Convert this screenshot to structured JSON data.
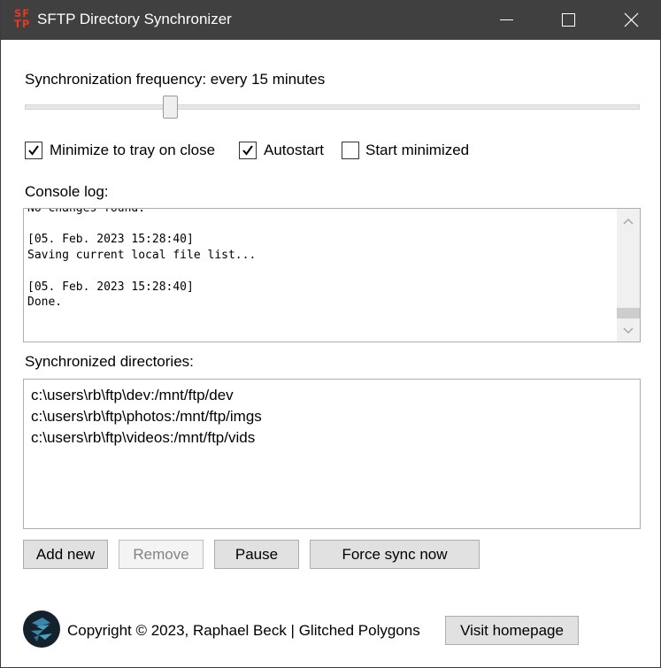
{
  "window": {
    "title": "SFTP Directory Synchronizer",
    "logo_text_top": "SF",
    "logo_text_bottom": "TP",
    "controls": [
      "minimize",
      "maximize",
      "close"
    ]
  },
  "sync": {
    "frequency_label": "Synchronization frequency: every 15 minutes",
    "slider_fraction": 0.23
  },
  "options": [
    {
      "label": "Minimize to tray on close",
      "checked": true
    },
    {
      "label": "Autostart",
      "checked": true
    },
    {
      "label": "Start minimized",
      "checked": false
    }
  ],
  "console": {
    "label": "Console log:",
    "lines": [
      "No changes found.",
      "",
      "[05. Feb. 2023 15:28:40]",
      "Saving current local file list...",
      "",
      "[05. Feb. 2023 15:28:40]",
      "Done."
    ]
  },
  "directories": {
    "label": "Synchronized directories:",
    "items": [
      "c:\\users\\rb\\ftp\\dev:/mnt/ftp/dev",
      "c:\\users\\rb\\ftp\\photos:/mnt/ftp/imgs",
      "c:\\users\\rb\\ftp\\videos:/mnt/ftp/vids"
    ]
  },
  "buttons": {
    "add_new": "Add new",
    "remove": "Remove",
    "pause": "Pause",
    "force_sync": "Force sync now",
    "visit_homepage": "Visit homepage"
  },
  "footer": {
    "copyright": "Copyright © 2023, Raphael Beck | Glitched Polygons"
  },
  "colors": {
    "titlebar": "#404040",
    "logo_red": "#e8391f",
    "brand_dark": "#14222e",
    "brand_blue": "#3a86a8"
  }
}
